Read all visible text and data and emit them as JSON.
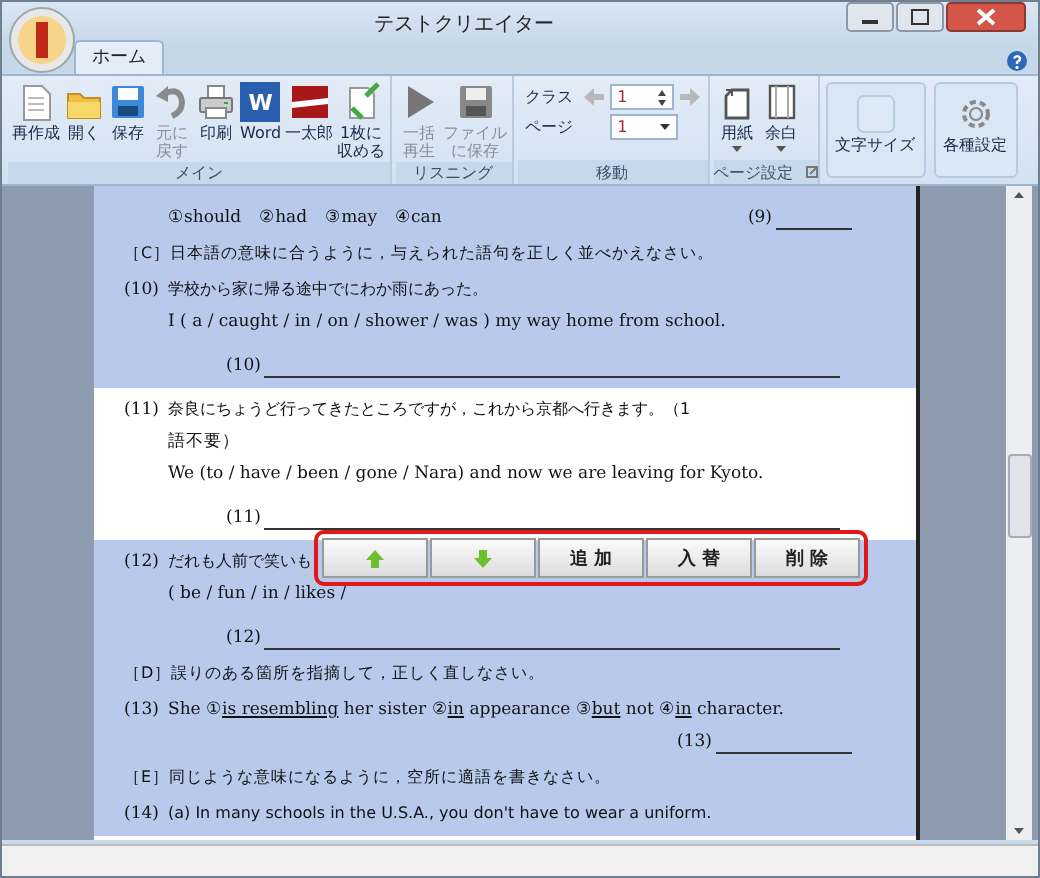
{
  "window": {
    "title": "テストクリエイター"
  },
  "tabs": [
    {
      "label": "ホーム",
      "selected": true
    }
  ],
  "ribbon": {
    "groups": [
      {
        "label": "メイン",
        "buttons": [
          {
            "label": "再作成",
            "disabled": false
          },
          {
            "label": "開く",
            "disabled": false
          },
          {
            "label": "保存",
            "disabled": false
          },
          {
            "label": "元に戻す",
            "disabled": true
          },
          {
            "label": "印刷",
            "disabled": false
          },
          {
            "label": "Word",
            "icon_text": "W",
            "disabled": false
          },
          {
            "label": "一太郎",
            "disabled": false
          },
          {
            "label": "1枚に収める",
            "disabled": false
          }
        ]
      },
      {
        "label": "リスニング",
        "buttons": [
          {
            "label": "一括再生",
            "disabled": true
          },
          {
            "label": "ファイルに保存",
            "disabled": true
          }
        ]
      },
      {
        "label": "移動",
        "navigator": {
          "class_label": "クラス",
          "class_value": "1",
          "page_label": "ページ",
          "page_value": "1"
        }
      },
      {
        "label": "ページ設定",
        "buttons": [
          {
            "label": "用紙",
            "disabled": false,
            "dropdown": true
          },
          {
            "label": "余白",
            "disabled": false,
            "dropdown": true
          }
        ],
        "launcher": true
      },
      {
        "buttons": [
          {
            "label": "文字サイズ",
            "disabled": false
          }
        ]
      },
      {
        "buttons": [
          {
            "label": "各種設定",
            "disabled": false
          }
        ]
      }
    ]
  },
  "document": {
    "blocks": [
      {
        "selected": true,
        "lines": [
          {
            "kind": "choices",
            "text": "①should　②had　③may　④can",
            "answer": "(9)"
          },
          {
            "kind": "heading",
            "text": "［C］日本語の意味に合うように，与えられた語句を正しく並べかえなさい。"
          },
          {
            "kind": "question",
            "number": "(10)",
            "text": "学校から家に帰る途中でにわか雨にあった。"
          },
          {
            "kind": "text",
            "text": "I ( a / caught / in / on / shower / was ) my way home from school."
          },
          {
            "kind": "answer",
            "number": "(10)"
          }
        ]
      },
      {
        "selected": false,
        "lines": [
          {
            "kind": "question",
            "number": "(11)",
            "text": "奈良にちょうど行ってきたところですが，これから京都へ行きます。（1"
          },
          {
            "kind": "text",
            "text": "語不要）"
          },
          {
            "kind": "text",
            "text": "We (to / have / been / gone / Nara) and now we are leaving for Kyoto."
          },
          {
            "kind": "answer",
            "number": "(11)"
          }
        ]
      },
      {
        "selected": true,
        "lines": [
          {
            "kind": "question",
            "number": "(12)",
            "text": "だれも人前で笑いも"
          },
          {
            "kind": "text",
            "text": "( be / fun / in / likes /"
          },
          {
            "kind": "answer",
            "number": "(12)"
          },
          {
            "kind": "heading",
            "text": "［D］誤りのある箇所を指摘して，正しく直しなさい。"
          },
          {
            "kind": "segments",
            "number": "(13)",
            "segments": [
              {
                "text": "She ①",
                "underlined": false
              },
              {
                "text": "is resembling",
                "underlined": true
              },
              {
                "text": " her sister ②",
                "underlined": false
              },
              {
                "text": "in",
                "underlined": true
              },
              {
                "text": " appearance ③",
                "underlined": false
              },
              {
                "text": "but",
                "underlined": true
              },
              {
                "text": " not ④",
                "underlined": false
              },
              {
                "text": "in",
                "underlined": true
              },
              {
                "text": " character.",
                "underlined": false
              }
            ]
          },
          {
            "kind": "answer_right",
            "number": "(13)"
          },
          {
            "kind": "heading",
            "text": "［E］同じような意味になるように，空所に適語を書きなさい。"
          },
          {
            "kind": "question",
            "number": "(14)",
            "text": "(a) In many schools in the U.S.A., you don't have to wear a uniform."
          }
        ]
      }
    ]
  },
  "floating_toolbar": {
    "buttons": [
      {
        "kind": "up"
      },
      {
        "kind": "down"
      },
      {
        "kind": "text",
        "label": "追 加"
      },
      {
        "kind": "text",
        "label": "入 替"
      },
      {
        "kind": "text",
        "label": "削 除"
      }
    ]
  }
}
